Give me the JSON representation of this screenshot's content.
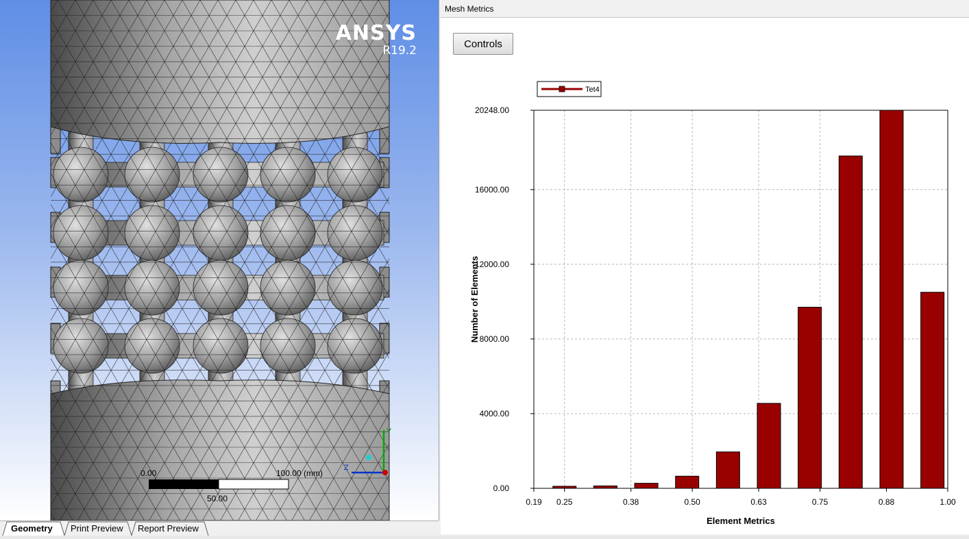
{
  "viewport": {
    "brand": "ANSYS",
    "version": "R19.2",
    "scale_start": "0.00",
    "scale_end": "100.00 (mm)",
    "scale_mid": "50.00",
    "axis_labels": {
      "z": "Z",
      "y": "Y"
    }
  },
  "tabs": [
    {
      "label": "Geometry",
      "active": true
    },
    {
      "label": "Print Preview",
      "active": false
    },
    {
      "label": "Report Preview",
      "active": false
    }
  ],
  "metrics_panel": {
    "title": "Mesh Metrics",
    "controls_label": "Controls"
  },
  "colors": {
    "bar": "#990000",
    "bar_edge": "#000000",
    "grid": "#b4b4b4"
  },
  "chart_data": {
    "type": "bar",
    "xlabel": "Element Metrics",
    "ylabel": "Number of Elements",
    "legend": "top-left",
    "grid": true,
    "xlim": [
      0.19,
      1.0
    ],
    "ylim": [
      0,
      20248
    ],
    "x_ticks": [
      "0.19",
      "0.25",
      "0.38",
      "0.50",
      "0.63",
      "0.75",
      "0.88",
      "1.00"
    ],
    "y_ticks": [
      "0.00",
      "4000.00",
      "8000.00",
      "12000.00",
      "16000.00",
      "20248.00"
    ],
    "series": [
      {
        "name": "Tet4",
        "x": [
          0.25,
          0.33,
          0.41,
          0.49,
          0.57,
          0.65,
          0.73,
          0.81,
          0.89,
          0.97
        ],
        "values": [
          110,
          130,
          270,
          650,
          1950,
          4550,
          9700,
          17800,
          20248,
          10500
        ]
      }
    ]
  }
}
